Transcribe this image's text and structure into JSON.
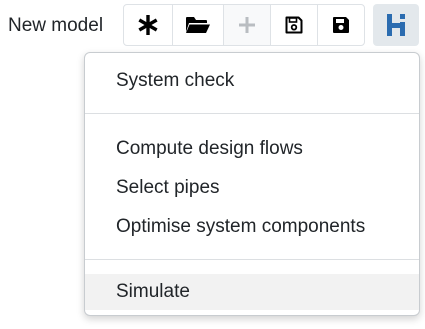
{
  "toolbar": {
    "model_name": "New model",
    "buttons": [
      {
        "name": "new-model-button",
        "icon": "asterisk-icon"
      },
      {
        "name": "open-model-button",
        "icon": "folder-open-icon"
      },
      {
        "name": "add-button",
        "icon": "plus-icon",
        "disabled": true
      },
      {
        "name": "save-as-button",
        "icon": "save-outline-icon"
      },
      {
        "name": "save-button",
        "icon": "save-icon"
      }
    ],
    "logo_button": {
      "icon": "hi-logo-icon",
      "color": "#2b6cb0"
    }
  },
  "menu": {
    "items": [
      {
        "label": "System check"
      },
      {
        "label": "Compute design flows"
      },
      {
        "label": "Select pipes"
      },
      {
        "label": "Optimise system components"
      },
      {
        "label": "Simulate",
        "highlighted": true
      }
    ]
  }
}
